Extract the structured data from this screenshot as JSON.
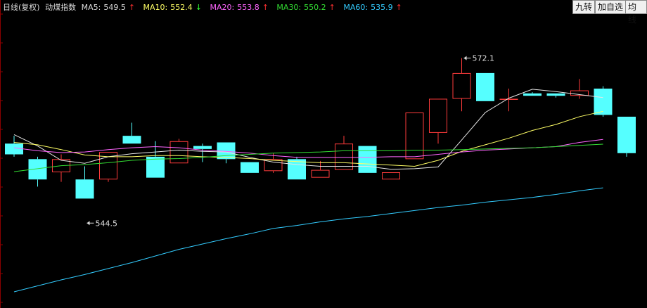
{
  "header": {
    "title": "日线(复权)",
    "index_name": "动煤指数",
    "ma5": {
      "label": "MA5:",
      "value": "549.5",
      "arrow": "↑",
      "color": "#e6e6e6",
      "arrow_color": "#ff3030"
    },
    "ma10": {
      "label": "MA10:",
      "value": "552.4",
      "arrow": "↓",
      "color": "#ffff66",
      "arrow_color": "#30ff30"
    },
    "ma20": {
      "label": "MA20:",
      "value": "553.8",
      "arrow": "↑",
      "color": "#ff66ff",
      "arrow_color": "#ff3030"
    },
    "ma30": {
      "label": "MA30:",
      "value": "550.2",
      "arrow": "↑",
      "color": "#33dd33",
      "arrow_color": "#ff3030"
    },
    "ma60": {
      "label": "MA60:",
      "value": "535.9",
      "arrow": "↑",
      "color": "#33ccff",
      "arrow_color": "#ff3030"
    }
  },
  "buttons": {
    "nine_turn": "九转",
    "add_watch": "加自选",
    "ma_line": "均线"
  },
  "colors": {
    "up": "#ff3b3b",
    "down": "#55ffff",
    "ma5": "#e6e6e6",
    "ma10": "#ffff66",
    "ma20": "#ff66ff",
    "ma30": "#33dd33",
    "ma60": "#33ccff",
    "axis": "#8b0000"
  },
  "chart_data": {
    "type": "candlestick",
    "ylim": [
      531,
      579
    ],
    "grid": false,
    "candles": [
      {
        "open": 557.8,
        "close": 556.0,
        "high": 559.1,
        "low": 555.6
      },
      {
        "open": 555.2,
        "close": 551.8,
        "high": 555.6,
        "low": 550.6
      },
      {
        "open": 553.0,
        "close": 555.2,
        "high": 556.0,
        "low": 551.4
      },
      {
        "open": 551.8,
        "close": 548.6,
        "high": 554.0,
        "low": 548.6
      },
      {
        "open": 551.8,
        "close": 556.4,
        "high": 556.4,
        "low": 551.4
      },
      {
        "open": 559.1,
        "close": 557.8,
        "high": 561.3,
        "low": 557.8
      },
      {
        "open": 555.6,
        "close": 552.1,
        "high": 558.2,
        "low": 552.1
      },
      {
        "open": 554.5,
        "close": 558.2,
        "high": 558.6,
        "low": 554.5
      },
      {
        "open": 557.4,
        "close": 556.9,
        "high": 557.8,
        "low": 554.7
      },
      {
        "open": 558.0,
        "close": 555.2,
        "high": 558.0,
        "low": 554.5
      },
      {
        "open": 554.7,
        "close": 552.9,
        "high": 554.7,
        "low": 552.9
      },
      {
        "open": 553.2,
        "close": 555.2,
        "high": 556.2,
        "low": 552.9
      },
      {
        "open": 555.2,
        "close": 551.8,
        "high": 555.6,
        "low": 551.8
      },
      {
        "open": 552.1,
        "close": 553.4,
        "high": 554.9,
        "low": 552.1
      },
      {
        "open": 553.4,
        "close": 557.8,
        "high": 559.1,
        "low": 553.4
      },
      {
        "open": 557.4,
        "close": 552.9,
        "high": 557.4,
        "low": 552.9
      },
      {
        "open": 551.8,
        "close": 553.0,
        "high": 553.0,
        "low": 551.8
      },
      {
        "open": 555.2,
        "close": 563.0,
        "high": 563.0,
        "low": 555.2
      },
      {
        "open": 559.6,
        "close": 565.3,
        "high": 565.3,
        "low": 557.8
      },
      {
        "open": 565.3,
        "close": 569.6,
        "high": 572.1,
        "low": 563.2
      },
      {
        "open": 569.6,
        "close": 564.9,
        "high": 569.6,
        "low": 564.9
      },
      {
        "open": 565.3,
        "close": 565.3,
        "high": 567.0,
        "low": 563.2
      },
      {
        "open": 566.2,
        "close": 565.8,
        "high": 566.4,
        "low": 565.8
      },
      {
        "open": 566.2,
        "close": 565.8,
        "high": 566.2,
        "low": 565.5
      },
      {
        "open": 565.8,
        "close": 566.7,
        "high": 568.6,
        "low": 565.3
      },
      {
        "open": 567.0,
        "close": 562.6,
        "high": 567.4,
        "low": 562.3
      },
      {
        "open": 562.3,
        "close": 556.2,
        "high": 562.3,
        "low": 555.6
      }
    ],
    "ma": {
      "MA5": [
        559.3,
        557.4,
        555.0,
        554.5,
        555.6,
        556.1,
        556.4,
        556.7,
        556.5,
        556.4,
        555.5,
        554.7,
        554.3,
        554.0,
        554.0,
        554.0,
        553.5,
        553.6,
        553.9,
        558.4,
        563.0,
        565.4,
        566.9,
        566.5,
        566.0,
        565.5,
        549.5
      ],
      "MA10": [
        558.0,
        557.6,
        556.8,
        555.9,
        555.6,
        555.6,
        555.8,
        555.8,
        555.6,
        555.5,
        555.3,
        555.0,
        554.8,
        554.6,
        554.6,
        554.4,
        554.2,
        554.0,
        555.0,
        556.5,
        557.6,
        558.7,
        560.0,
        561.0,
        562.3,
        563.2,
        552.4
      ],
      "MA20": [
        557.1,
        556.6,
        556.3,
        556.4,
        556.8,
        557.1,
        557.3,
        557.1,
        556.7,
        556.5,
        556.2,
        555.8,
        555.5,
        555.5,
        555.5,
        555.5,
        555.6,
        555.6,
        556.0,
        556.4,
        556.7,
        556.9,
        557.1,
        557.3,
        558.0,
        558.5,
        553.8
      ],
      "MA30": [
        553.1,
        553.6,
        554.1,
        554.3,
        554.6,
        555.0,
        555.2,
        555.3,
        555.5,
        555.8,
        556.0,
        556.2,
        556.3,
        556.4,
        556.6,
        556.6,
        556.6,
        556.7,
        556.7,
        556.8,
        556.9,
        557.0,
        557.1,
        557.3,
        557.5,
        557.7,
        550.2
      ],
      "MA60": [
        533.0,
        534.0,
        535.0,
        535.9,
        536.9,
        537.9,
        539.0,
        540.1,
        541.0,
        541.9,
        542.7,
        543.6,
        544.1,
        544.7,
        545.2,
        545.6,
        546.1,
        546.6,
        547.1,
        547.5,
        548.0,
        548.4,
        548.8,
        549.3,
        549.9,
        550.4,
        535.9
      ]
    },
    "annotations": [
      {
        "text": "572.1",
        "index": 19,
        "value": 572.1,
        "side": "right"
      },
      {
        "text": "544.5",
        "index": 3,
        "value": 544.5,
        "side": "right"
      }
    ]
  }
}
